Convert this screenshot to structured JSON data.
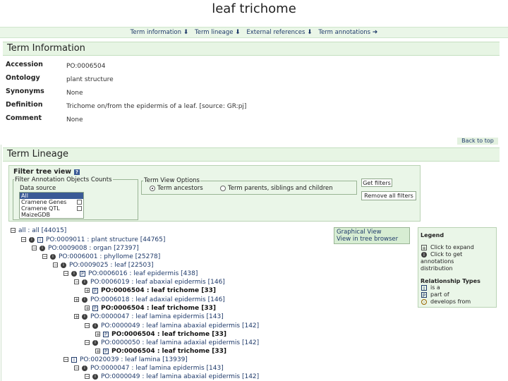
{
  "page_title": "leaf trichome",
  "nav": {
    "links": [
      "Term information",
      "Term lineage",
      "External references",
      "Term annotations"
    ]
  },
  "term_info": {
    "heading": "Term Information",
    "rows": [
      {
        "label": "Accession",
        "value": "PO:0006504"
      },
      {
        "label": "Ontology",
        "value": "plant structure"
      },
      {
        "label": "Synonyms",
        "value": "None"
      },
      {
        "label": "Definition",
        "value": "Trichome on/from the epidermis of a leaf. [source: GR:pj]"
      },
      {
        "label": "Comment",
        "value": "None"
      }
    ],
    "back_to_top": "Back to top"
  },
  "lineage": {
    "heading": "Term Lineage",
    "filter_title": "Filter tree view",
    "annotation_legend": "Filter Annotation Objects Counts",
    "datasource_label": "Data source",
    "datasource_options": [
      "All",
      "Cramene Genes",
      "Cramene QTL",
      "MaizeGDB"
    ],
    "view_legend": "Term View Options",
    "radio_ancestors": "Term ancestors",
    "radio_parents": "Term parents, siblings and children",
    "btn_get": "Get filters",
    "btn_remove": "Remove all filters",
    "graphical_view": "Graphical View",
    "tree_browser": "View in tree browser",
    "tree": [
      "all : all [44015]",
      "PO:0009011 : plant structure [44765]",
      "PO:0009008 : organ [27397]",
      "PO:0006001 : phyllome [25278]",
      "PO:0009025 : leaf [22503]",
      "PO:0006016 : leaf epidermis [438]",
      "PO:0006019 : leaf abaxial epidermis [146]",
      "PO:0006504 : leaf trichome [33]",
      "PO:0006018 : leaf adaxial epidermis [146]",
      "PO:0006504 : leaf trichome [33]",
      "PO:0000047 : leaf lamina epidermis [143]",
      "PO:0000049 : leaf lamina abaxial epidermis [142]",
      "PO:0006504 : leaf trichome [33]",
      "PO:0000050 : leaf lamina adaxial epidermis [142]",
      "PO:0006504 : leaf trichome [33]",
      "PO:0020039 : leaf lamina [13939]",
      "PO:0000047 : leaf lamina epidermis [143]",
      "PO:0000049 : leaf lamina abaxial epidermis [142]"
    ]
  },
  "legend": {
    "title": "Legend",
    "expand": "Click to expand",
    "annotations": [
      "Click to get",
      "annotations",
      "distribution"
    ],
    "rel_types_title": "Relationship Types",
    "is_a": "is a",
    "part_of": "part of",
    "develops_from": "develops from"
  },
  "colors": {
    "section_bg": "#e7f5e4",
    "link": "#1f3a6a",
    "dot": "#3d3d3d"
  }
}
